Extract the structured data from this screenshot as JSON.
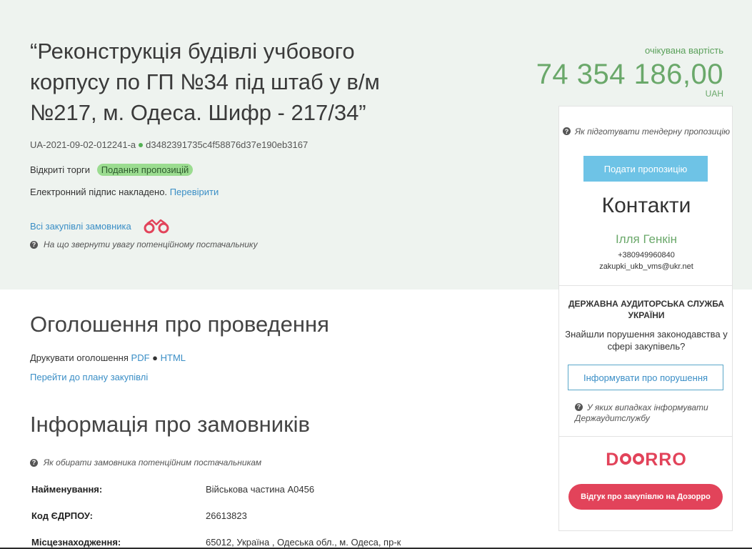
{
  "lot": {
    "title": "“Реконструкція будівлі учбового корпусу по ГП №34 під штаб у в/м №217, м. Одеса. Шифр - 217/34”",
    "tender_id": "UA-2021-09-02-012241-a",
    "hash": "d3482391735c4f58876d37e190eb3167",
    "procedure": "Відкриті торги",
    "status": "Подання пропозицій",
    "signature_text": "Електронний підпис накладено.",
    "signature_link": "Перевірити",
    "all_purchases_link": "Всі закупівлі замовника",
    "supplier_hint": "На що звернути увагу потенційному постачальнику"
  },
  "price": {
    "label": "очікувана вартість",
    "value": "74 354 186,00",
    "currency": "UAH"
  },
  "sidebar": {
    "tender_hint": "Як підготувати тендерну пропозицію",
    "submit_button": "Подати пропозицію",
    "contacts_title": "Контакти",
    "contact_name": "Ілля Генкін",
    "contact_phone": "+380949960840",
    "contact_email": "zakupki_ukb_vms@ukr.net",
    "dasu_title": "ДЕРЖАВНА АУДИТОРСЬКА СЛУЖБА УКРАЇНИ",
    "dasu_text": "Знайшли порушення законодавства у сфері закупівель?",
    "report_button": "Інформувати про порушення",
    "dasu_hint": "У яких випадках інформувати Держаудитслужбу",
    "dozorro_prefix": "D",
    "dozorro_suffix": "RRO",
    "dozorro_button": "Відгук про закупівлю на Дозорро"
  },
  "notice": {
    "title": "Оголошення про проведення",
    "print_label": "Друкувати оголошення",
    "pdf_link": "PDF",
    "html_link": "HTML",
    "plan_link": "Перейти до плану закупівлі"
  },
  "buyers": {
    "title": "Інформація про замовників",
    "hint": "Як обирати замовника потенційним постачальникам",
    "rows": [
      {
        "label": "Найменування:",
        "value": "Військова частина А0456"
      },
      {
        "label": "Код ЄДРПОУ:",
        "value": "26613823"
      },
      {
        "label": "Місцезнаходження:",
        "value": "65012, Україна , Одеська обл., м. Одеса, пр-к"
      }
    ]
  },
  "colors": {
    "hero_bg": "#eef3ef",
    "price_green": "#6aa86a",
    "link_blue": "#3a8ec6",
    "submit_blue": "#6ec3e6",
    "dozorro_red": "#e2435a",
    "status_badge": "#9bdc90"
  }
}
